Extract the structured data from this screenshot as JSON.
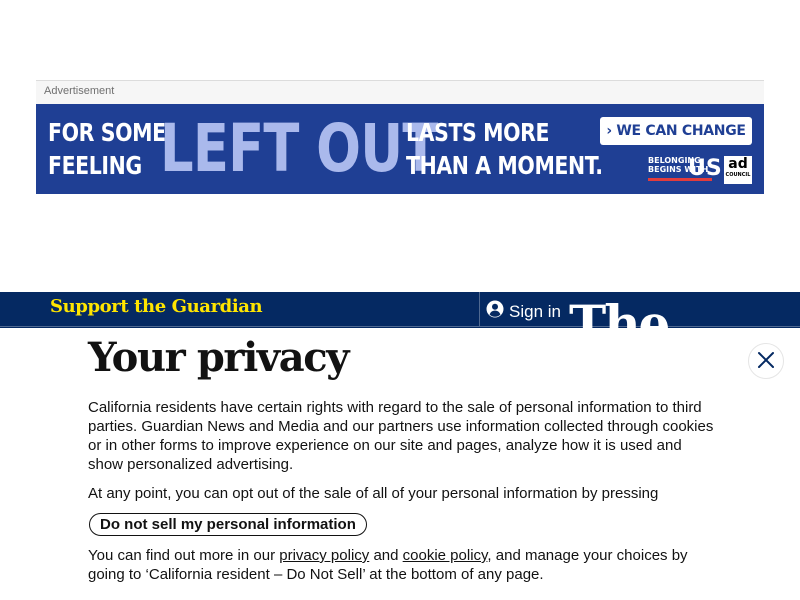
{
  "advertisement": {
    "label": "Advertisement",
    "banner": {
      "line1": "FOR SOME,",
      "line2": "FEELING",
      "big_text": "LEFT OUT",
      "line3": "LASTS MORE",
      "line4": "THAN A MOMENT.",
      "cta": "› WE CAN CHANGE THAT",
      "belonging_line1": "BELONGING",
      "belonging_line2": "BEGINS WITH",
      "belonging_us": "US",
      "council_ad": "ad",
      "council_word": "COUNCIL",
      "colors": {
        "background": "#1f3f94",
        "big_text": "#aab9ec",
        "stripe": "#e23c3c"
      }
    }
  },
  "header": {
    "support_link": "Support the Guardian",
    "signin_label": "Sign in",
    "signin_icon": "user-icon",
    "logo_text": "The",
    "colors": {
      "background": "#052962",
      "support": "#ffe500"
    }
  },
  "privacy_modal": {
    "title": "Your privacy",
    "close_icon": "close-icon",
    "paragraph1": "California residents have certain rights with regard to the sale of personal information to third parties. Guardian News and Media and our partners use information collected through cookies or in other forms to improve experience on our site and pages, analyze how it is used and show personalized advertising.",
    "paragraph2": "At any point, you can opt out of the sale of all of your personal information by pressing",
    "do_not_sell_button": "Do not sell my personal information",
    "paragraph3_part1": "You can find out more in our",
    "privacy_policy_link": "privacy policy",
    "paragraph3_and": "and",
    "cookie_policy_link": "cookie policy",
    "paragraph3_part2": ", and manage your choices by going to ‘California resident – Do Not Sell’ at the bottom of any page."
  }
}
